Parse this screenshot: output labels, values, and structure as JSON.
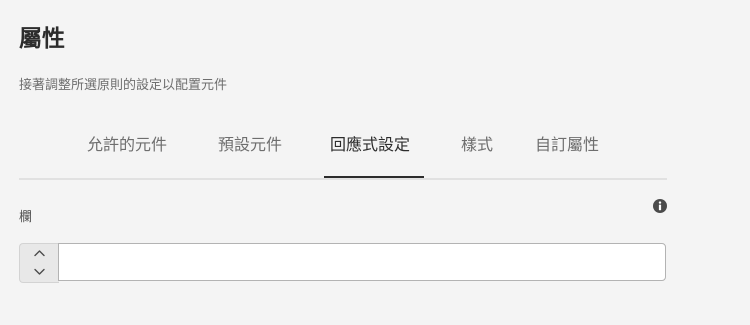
{
  "panel": {
    "title": "屬性",
    "description": "接著調整所選原則的設定以配置元件"
  },
  "tabs": [
    {
      "label": "允許的元件",
      "selected": false
    },
    {
      "label": "預設元件",
      "selected": false
    },
    {
      "label": "回應式設定",
      "selected": true
    },
    {
      "label": "樣式",
      "selected": false
    },
    {
      "label": "自訂屬性",
      "selected": false
    }
  ],
  "field": {
    "label": "欄",
    "value": "",
    "placeholder": ""
  },
  "icons": {
    "info": "info-icon",
    "increment": "chevron-up-icon",
    "decrement": "chevron-down-icon"
  },
  "colors": {
    "background": "#f4f4f4",
    "selected_tab_indicator": "#2c2c2c",
    "text_primary": "#2c2c2c",
    "text_secondary": "#6e6e6e"
  }
}
